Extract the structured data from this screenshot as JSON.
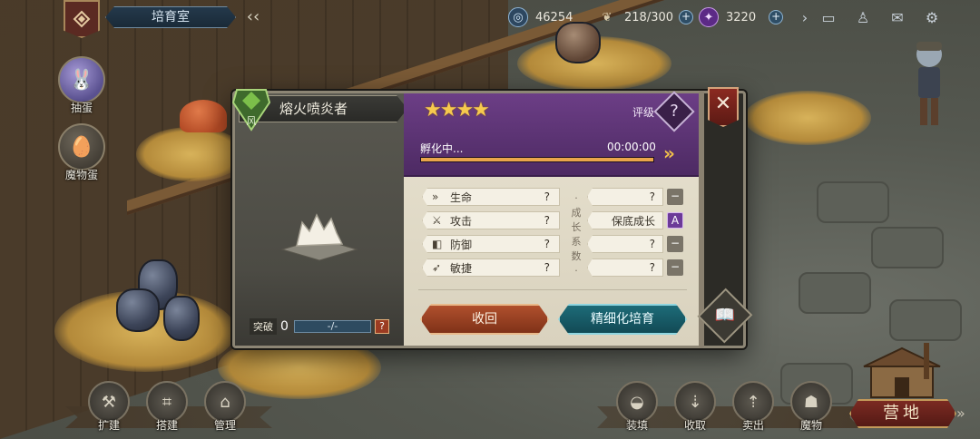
{
  "topbar": {
    "room_title": "培育室",
    "resources": [
      {
        "icon": "soul-orb-icon",
        "value": "46254"
      },
      {
        "icon": "food-leaf-icon",
        "value": "218/300"
      },
      {
        "icon": "purple-gem-icon",
        "value": "3220"
      }
    ],
    "plus": "+"
  },
  "side_buttons": [
    {
      "label": "抽蛋",
      "icon": "rabbit-egg-icon"
    },
    {
      "label": "魔物蛋",
      "icon": "egg-nest-icon"
    }
  ],
  "bottom_left": [
    {
      "label": "扩建",
      "icon": "hammer-plus-icon"
    },
    {
      "label": "搭建",
      "icon": "fence-icon"
    },
    {
      "label": "管理",
      "icon": "house-gear-icon"
    }
  ],
  "bottom_right": [
    {
      "label": "装填",
      "icon": "egg-load-icon"
    },
    {
      "label": "收取",
      "icon": "collect-icon"
    },
    {
      "label": "卖出",
      "icon": "sell-icon"
    },
    {
      "label": "魔物",
      "icon": "monster-face-icon"
    }
  ],
  "camp_label": "营地",
  "camp_arrow": "»",
  "dialog": {
    "monster_name": "熔火喷炎者",
    "element_glyph": "风",
    "stars": "★★★★",
    "rank_label": "评级",
    "rank_value": "?",
    "hatch_status": "孵化中...",
    "hatch_time": "00:00:00",
    "hatch_progress": 1.0,
    "fast_forward": "»",
    "breakthrough_label": "突破",
    "breakthrough_value": "0",
    "breakthrough_bar": "-/-",
    "breakthrough_help": "?",
    "stats": [
      {
        "name": "生命",
        "value": "?",
        "icon": "hp-chevron-icon"
      },
      {
        "name": "攻击",
        "value": "?",
        "icon": "sword-icon"
      },
      {
        "name": "防御",
        "value": "?",
        "icon": "shield-icon"
      },
      {
        "name": "敏捷",
        "value": "?",
        "icon": "wing-icon"
      }
    ],
    "growth_label": "·成长系数·",
    "growth": [
      {
        "value": "?",
        "mark": "−"
      },
      {
        "value": "保底成长",
        "mark": "A"
      },
      {
        "value": "?",
        "mark": "−"
      },
      {
        "value": "?",
        "mark": "−"
      }
    ],
    "recall_button": "收回",
    "refine_button": "精细化培育",
    "close_glyph": "✕"
  }
}
